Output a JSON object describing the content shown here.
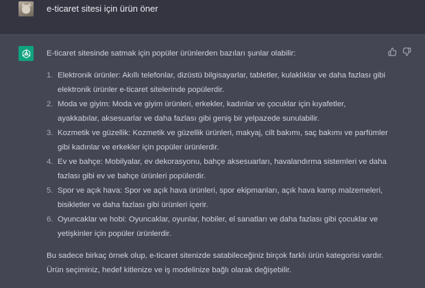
{
  "user": {
    "message": "e-ticaret sitesi için ürün öner",
    "avatar_icon": "user-avatar-cat"
  },
  "assistant": {
    "avatar_icon": "openai-logo-icon",
    "avatar_color": "#10a37f",
    "intro": "E-ticaret sitesinde satmak için popüler ürünlerden bazıları şunlar olabilir:",
    "items": [
      {
        "num": "1.",
        "text": "Elektronik ürünler: Akıllı telefonlar, dizüstü bilgisayarlar, tabletler, kulaklıklar ve daha fazlası gibi elektronik ürünler e-ticaret sitelerinde popülerdir."
      },
      {
        "num": "2.",
        "text": "Moda ve giyim: Moda ve giyim ürünleri, erkekler, kadınlar ve çocuklar için kıyafetler, ayakkabılar, aksesuarlar ve daha fazlası gibi geniş bir yelpazede sunulabilir."
      },
      {
        "num": "3.",
        "text": "Kozmetik ve güzellik: Kozmetik ve güzellik ürünleri, makyaj, cilt bakımı, saç bakımı ve parfümler gibi kadınlar ve erkekler için popüler ürünlerdir."
      },
      {
        "num": "4.",
        "text": "Ev ve bahçe: Mobilyalar, ev dekorasyonu, bahçe aksesuarları, havalandırma sistemleri ve daha fazlası gibi ev ve bahçe ürünleri popülerdir."
      },
      {
        "num": "5.",
        "text": "Spor ve açık hava: Spor ve açık hava ürünleri, spor ekipmanları, açık hava kamp malzemeleri, bisikletler ve daha fazlası gibi ürünleri içerir."
      },
      {
        "num": "6.",
        "text": "Oyuncaklar ve hobi: Oyuncaklar, oyunlar, hobiler, el sanatları ve daha fazlası gibi çocuklar ve yetişkinler için popüler ürünlerdir."
      }
    ],
    "outro": "Bu sadece birkaç örnek olup, e-ticaret sitenizde satabileceğiniz birçok farklı ürün kategorisi vardır. Ürün seçiminiz, hedef kitlenize ve iş modelinize bağlı olarak değişebilir.",
    "feedback_icons": [
      "thumbs-up-icon",
      "thumbs-down-icon"
    ]
  },
  "colors": {
    "user_row_bg": "#343541",
    "assistant_row_bg": "#444654",
    "text": "#d1d5db"
  }
}
